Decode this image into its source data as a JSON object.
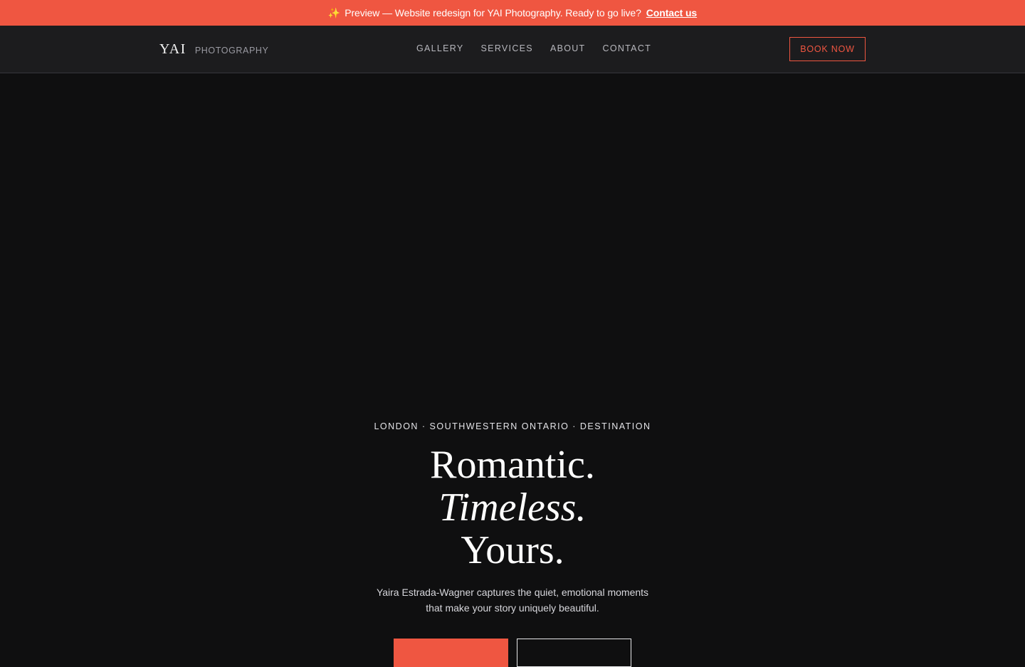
{
  "banner": {
    "icon": "sparkles-icon",
    "icon_glyph": "✨",
    "message": "Preview — Website redesign for YAI Photography. Ready to go live?",
    "link_label": "Contact us",
    "bg_color": "#ef5641"
  },
  "nav": {
    "brand_mark": "YAI",
    "brand_sub": "PHOTOGRAPHY",
    "links": [
      {
        "label": "GALLERY"
      },
      {
        "label": "SERVICES"
      },
      {
        "label": "ABOUT"
      },
      {
        "label": "CONTACT"
      }
    ],
    "book_label": "BOOK NOW",
    "accent_color": "#ef5641"
  },
  "hero": {
    "eyebrow": "LONDON · SOUTHWESTERN ONTARIO · DESTINATION",
    "headline_1": "Romantic.",
    "headline_2": "Timeless.",
    "headline_3": "Yours.",
    "lede": "Yaira Estrada-Wagner captures the quiet, emotional moments that make your story uniquely beautiful."
  }
}
